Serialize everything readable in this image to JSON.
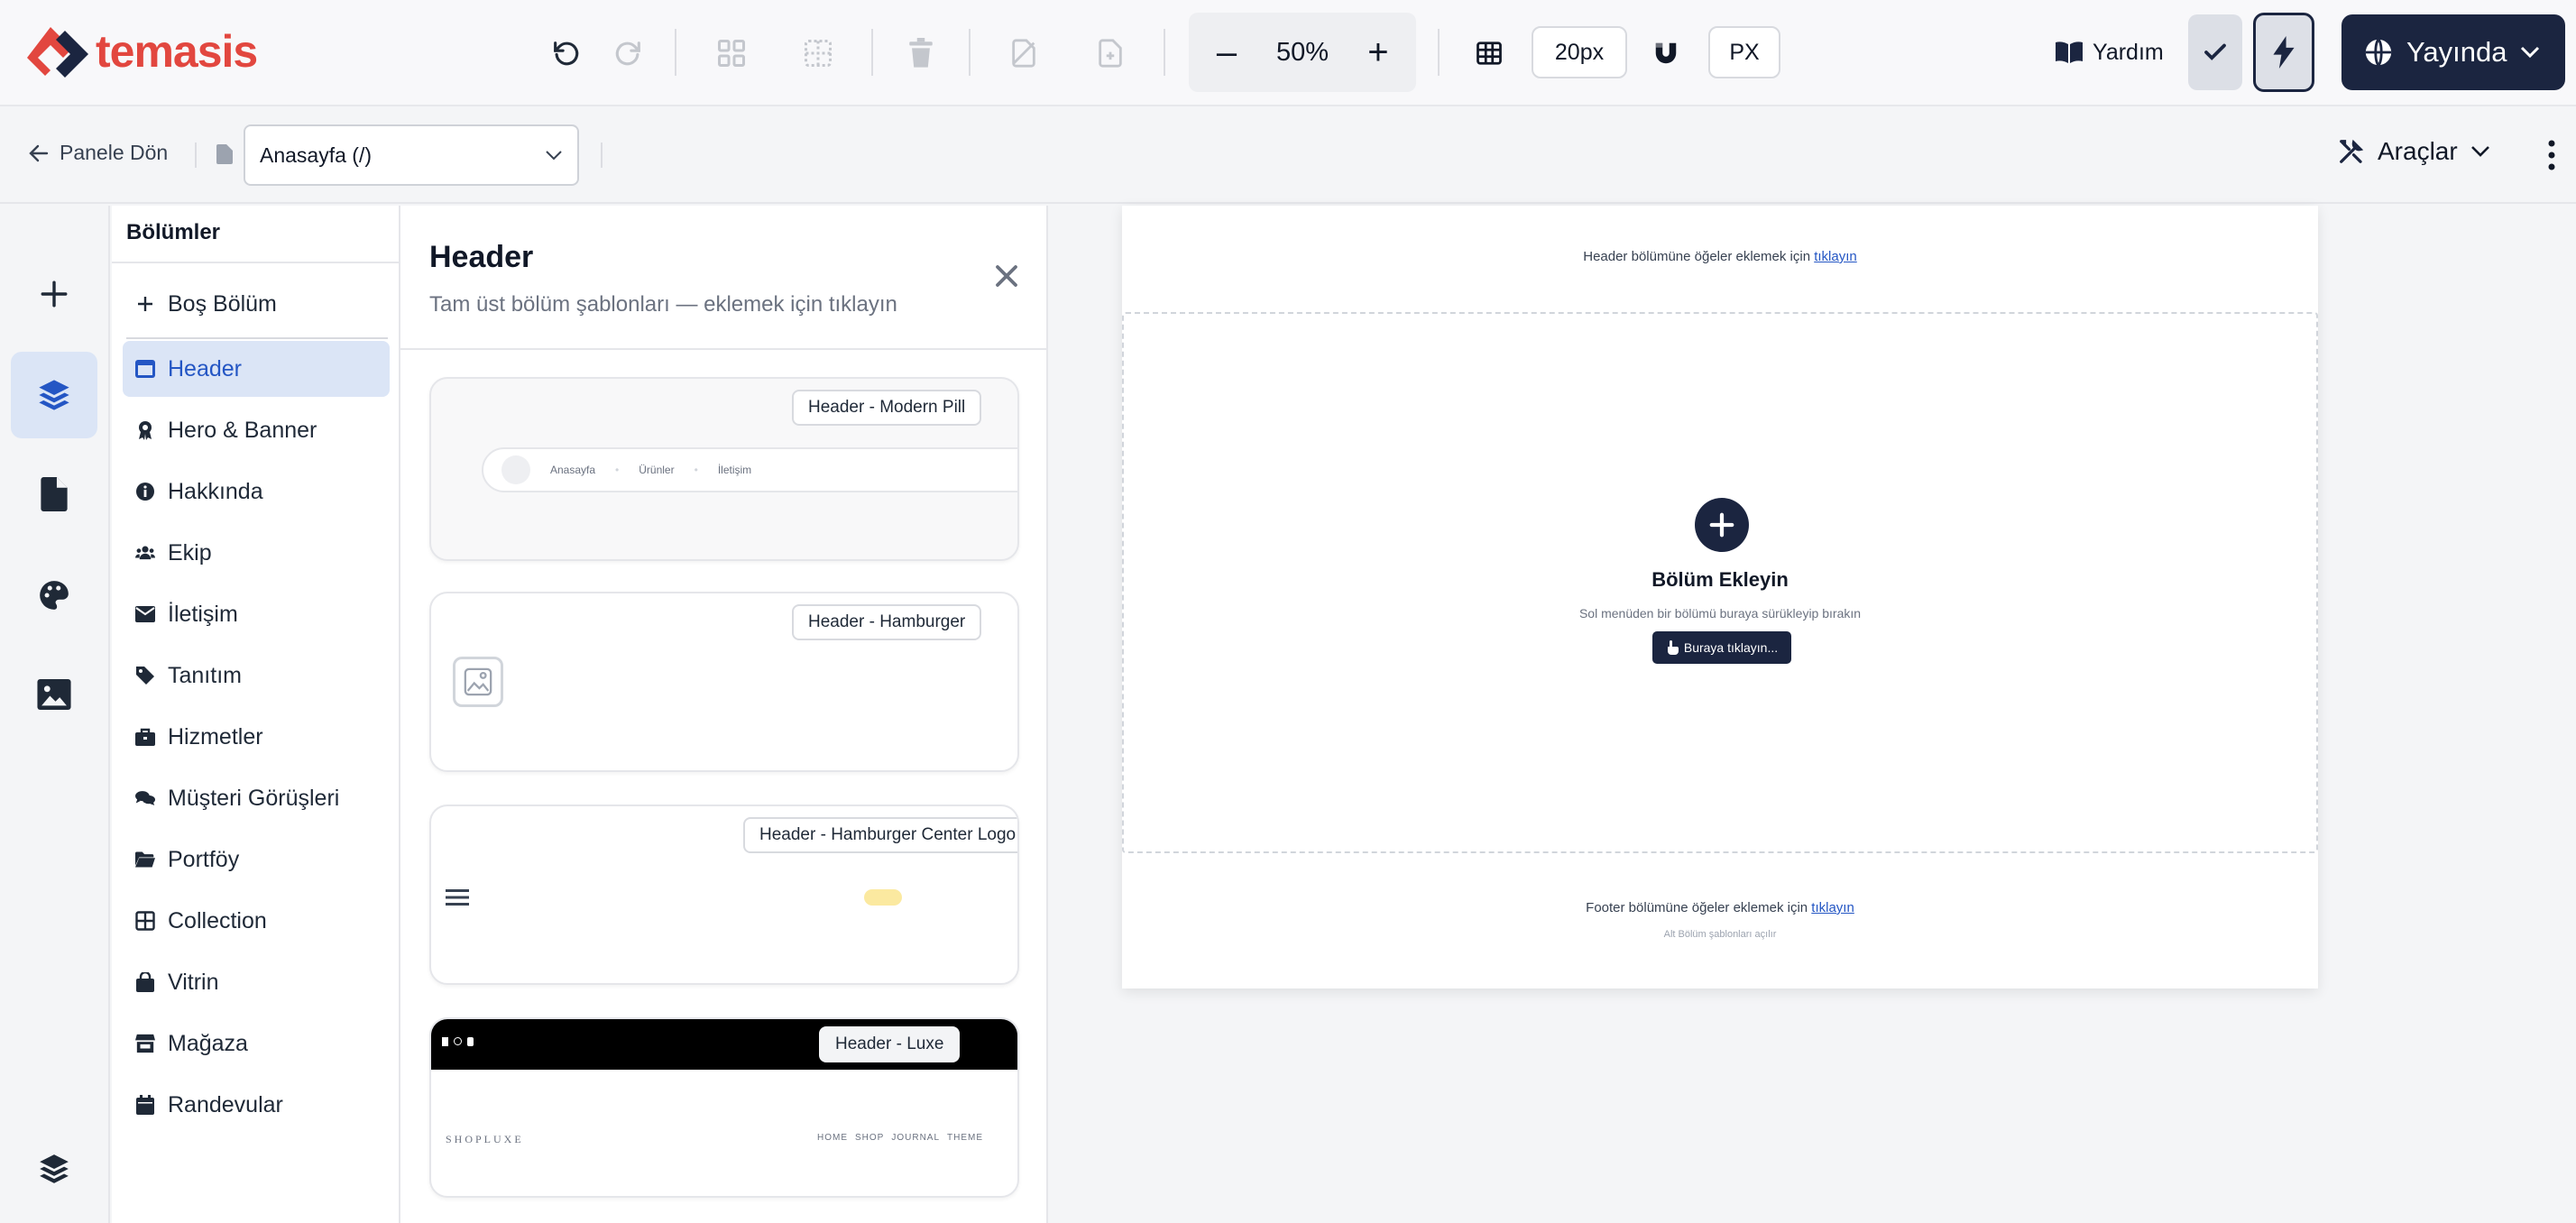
{
  "brand": {
    "name": "temasis",
    "color": "#e2473f"
  },
  "toolbar": {
    "zoom_value": "50%",
    "zoom_out_symbol": "–",
    "zoom_in_symbol": "+",
    "grid_size": "20px",
    "unit": "PX",
    "help_label": "Yardım",
    "publish_label": "Yayında",
    "icons": [
      "undo-icon",
      "redo-icon",
      "group-icon",
      "ungroup-icon",
      "delete-icon",
      "duplicate-icon",
      "add-page-icon",
      "grid-icon",
      "magnet-icon",
      "book-icon",
      "check-icon",
      "bolt-icon",
      "globe-icon",
      "chevron-down-icon"
    ]
  },
  "subbar": {
    "back_label": "Panele Dön",
    "page_select_value": "Anasayfa (/)",
    "tools_label": "Araçlar"
  },
  "rail": {
    "items": [
      "add-icon",
      "layers-icon",
      "page-icon",
      "palette-icon",
      "image-icon",
      "stack-icon"
    ]
  },
  "sections": {
    "title": "Bölümler",
    "items": [
      {
        "label": "Boş Bölüm",
        "icon": "plus-icon"
      },
      {
        "label": "Header",
        "icon": "window-icon",
        "active": true
      },
      {
        "label": "Hero & Banner",
        "icon": "award-icon"
      },
      {
        "label": "Hakkında",
        "icon": "info-icon"
      },
      {
        "label": "Ekip",
        "icon": "users-icon"
      },
      {
        "label": "İletişim",
        "icon": "envelope-icon"
      },
      {
        "label": "Tanıtım",
        "icon": "tag-icon"
      },
      {
        "label": "Hizmetler",
        "icon": "briefcase-icon"
      },
      {
        "label": "Müşteri Görüşleri",
        "icon": "comments-icon"
      },
      {
        "label": "Portföy",
        "icon": "folder-icon"
      },
      {
        "label": "Collection",
        "icon": "table-icon"
      },
      {
        "label": "Vitrin",
        "icon": "bag-icon"
      },
      {
        "label": "Mağaza",
        "icon": "store-icon"
      },
      {
        "label": "Randevular",
        "icon": "calendar-icon"
      }
    ]
  },
  "templates": {
    "title": "Header",
    "subtitle": "Tam üst bölüm şablonları — eklemek için tıklayın",
    "cards": [
      {
        "label": "Header - Modern Pill",
        "nav": [
          "Anasayfa",
          "Ürünler",
          "İletişim"
        ]
      },
      {
        "label": "Header - Hamburger"
      },
      {
        "label": "Header - Hamburger Center Logo"
      },
      {
        "label": "Header - Luxe",
        "brand": "SHOPLUXE",
        "nav": [
          "HOME",
          "SHOP",
          "JOURNAL",
          "THEME"
        ]
      }
    ]
  },
  "canvas": {
    "header_hint_prefix": "Header bölümüne öğeler eklemek için",
    "header_hint_link": "tıklayın",
    "add_title": "Bölüm Ekleyin",
    "add_subtitle": "Sol menüden bir bölümü buraya sürükleyip bırakın",
    "add_button": "Buraya tıklayın...",
    "footer_hint_prefix": "Footer bölümüne öğeler eklemek için",
    "footer_hint_link": "tıklayın",
    "footer_sub": "Alt Bölüm şablonları açılır"
  },
  "colors": {
    "navy": "#1b2540",
    "active_bg": "#dbe5f6",
    "active_text": "#2456c4"
  }
}
